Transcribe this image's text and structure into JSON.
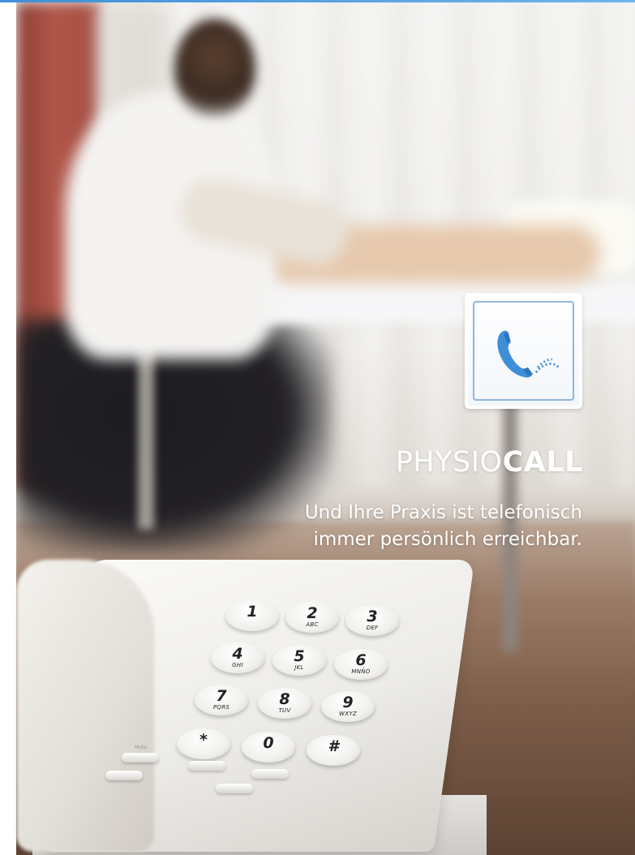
{
  "brand": {
    "title_part1": "PHYSIO",
    "title_part2": "CALL",
    "tagline_line1": "Und Ihre Praxis ist telefonisch",
    "tagline_line2": "immer persönlich erreichbar.",
    "logo_icon": "telephone-handset-icon"
  },
  "phone": {
    "keys": [
      {
        "digit": "1",
        "letters": ""
      },
      {
        "digit": "2",
        "letters": "ABC"
      },
      {
        "digit": "3",
        "letters": "DEF"
      },
      {
        "digit": "4",
        "letters": "GHI"
      },
      {
        "digit": "5",
        "letters": "JKL"
      },
      {
        "digit": "6",
        "letters": "MNÑO"
      },
      {
        "digit": "7",
        "letters": "PQRS"
      },
      {
        "digit": "8",
        "letters": "TUV"
      },
      {
        "digit": "9",
        "letters": "WXYZ"
      },
      {
        "digit": "*",
        "letters": ""
      },
      {
        "digit": "0",
        "letters": ""
      },
      {
        "digit": "#",
        "letters": ""
      }
    ],
    "mute_label": "Mute"
  },
  "colors": {
    "accent_blue": "#3f8fd8",
    "logo_border": "#8fb6dd",
    "text_white": "#ffffff"
  }
}
